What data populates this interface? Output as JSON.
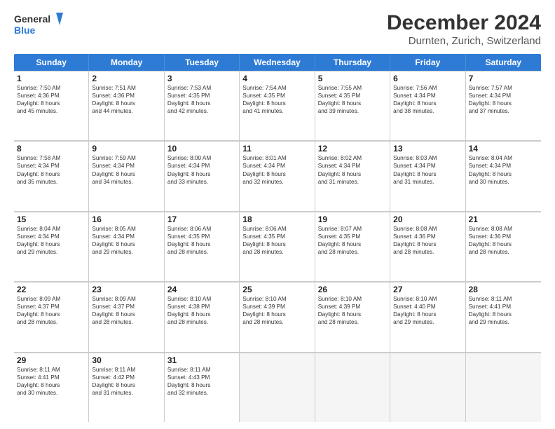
{
  "header": {
    "logo_general": "General",
    "logo_blue": "Blue",
    "month": "December 2024",
    "location": "Durnten, Zurich, Switzerland"
  },
  "weekdays": [
    "Sunday",
    "Monday",
    "Tuesday",
    "Wednesday",
    "Thursday",
    "Friday",
    "Saturday"
  ],
  "rows": [
    [
      {
        "day": "1",
        "lines": [
          "Sunrise: 7:50 AM",
          "Sunset: 4:36 PM",
          "Daylight: 8 hours",
          "and 45 minutes."
        ]
      },
      {
        "day": "2",
        "lines": [
          "Sunrise: 7:51 AM",
          "Sunset: 4:36 PM",
          "Daylight: 8 hours",
          "and 44 minutes."
        ]
      },
      {
        "day": "3",
        "lines": [
          "Sunrise: 7:53 AM",
          "Sunset: 4:35 PM",
          "Daylight: 8 hours",
          "and 42 minutes."
        ]
      },
      {
        "day": "4",
        "lines": [
          "Sunrise: 7:54 AM",
          "Sunset: 4:35 PM",
          "Daylight: 8 hours",
          "and 41 minutes."
        ]
      },
      {
        "day": "5",
        "lines": [
          "Sunrise: 7:55 AM",
          "Sunset: 4:35 PM",
          "Daylight: 8 hours",
          "and 39 minutes."
        ]
      },
      {
        "day": "6",
        "lines": [
          "Sunrise: 7:56 AM",
          "Sunset: 4:34 PM",
          "Daylight: 8 hours",
          "and 38 minutes."
        ]
      },
      {
        "day": "7",
        "lines": [
          "Sunrise: 7:57 AM",
          "Sunset: 4:34 PM",
          "Daylight: 8 hours",
          "and 37 minutes."
        ]
      }
    ],
    [
      {
        "day": "8",
        "lines": [
          "Sunrise: 7:58 AM",
          "Sunset: 4:34 PM",
          "Daylight: 8 hours",
          "and 35 minutes."
        ]
      },
      {
        "day": "9",
        "lines": [
          "Sunrise: 7:59 AM",
          "Sunset: 4:34 PM",
          "Daylight: 8 hours",
          "and 34 minutes."
        ]
      },
      {
        "day": "10",
        "lines": [
          "Sunrise: 8:00 AM",
          "Sunset: 4:34 PM",
          "Daylight: 8 hours",
          "and 33 minutes."
        ]
      },
      {
        "day": "11",
        "lines": [
          "Sunrise: 8:01 AM",
          "Sunset: 4:34 PM",
          "Daylight: 8 hours",
          "and 32 minutes."
        ]
      },
      {
        "day": "12",
        "lines": [
          "Sunrise: 8:02 AM",
          "Sunset: 4:34 PM",
          "Daylight: 8 hours",
          "and 31 minutes."
        ]
      },
      {
        "day": "13",
        "lines": [
          "Sunrise: 8:03 AM",
          "Sunset: 4:34 PM",
          "Daylight: 8 hours",
          "and 31 minutes."
        ]
      },
      {
        "day": "14",
        "lines": [
          "Sunrise: 8:04 AM",
          "Sunset: 4:34 PM",
          "Daylight: 8 hours",
          "and 30 minutes."
        ]
      }
    ],
    [
      {
        "day": "15",
        "lines": [
          "Sunrise: 8:04 AM",
          "Sunset: 4:34 PM",
          "Daylight: 8 hours",
          "and 29 minutes."
        ]
      },
      {
        "day": "16",
        "lines": [
          "Sunrise: 8:05 AM",
          "Sunset: 4:34 PM",
          "Daylight: 8 hours",
          "and 29 minutes."
        ]
      },
      {
        "day": "17",
        "lines": [
          "Sunrise: 8:06 AM",
          "Sunset: 4:35 PM",
          "Daylight: 8 hours",
          "and 28 minutes."
        ]
      },
      {
        "day": "18",
        "lines": [
          "Sunrise: 8:06 AM",
          "Sunset: 4:35 PM",
          "Daylight: 8 hours",
          "and 28 minutes."
        ]
      },
      {
        "day": "19",
        "lines": [
          "Sunrise: 8:07 AM",
          "Sunset: 4:35 PM",
          "Daylight: 8 hours",
          "and 28 minutes."
        ]
      },
      {
        "day": "20",
        "lines": [
          "Sunrise: 8:08 AM",
          "Sunset: 4:36 PM",
          "Daylight: 8 hours",
          "and 28 minutes."
        ]
      },
      {
        "day": "21",
        "lines": [
          "Sunrise: 8:08 AM",
          "Sunset: 4:36 PM",
          "Daylight: 8 hours",
          "and 28 minutes."
        ]
      }
    ],
    [
      {
        "day": "22",
        "lines": [
          "Sunrise: 8:09 AM",
          "Sunset: 4:37 PM",
          "Daylight: 8 hours",
          "and 28 minutes."
        ]
      },
      {
        "day": "23",
        "lines": [
          "Sunrise: 8:09 AM",
          "Sunset: 4:37 PM",
          "Daylight: 8 hours",
          "and 28 minutes."
        ]
      },
      {
        "day": "24",
        "lines": [
          "Sunrise: 8:10 AM",
          "Sunset: 4:38 PM",
          "Daylight: 8 hours",
          "and 28 minutes."
        ]
      },
      {
        "day": "25",
        "lines": [
          "Sunrise: 8:10 AM",
          "Sunset: 4:39 PM",
          "Daylight: 8 hours",
          "and 28 minutes."
        ]
      },
      {
        "day": "26",
        "lines": [
          "Sunrise: 8:10 AM",
          "Sunset: 4:39 PM",
          "Daylight: 8 hours",
          "and 28 minutes."
        ]
      },
      {
        "day": "27",
        "lines": [
          "Sunrise: 8:10 AM",
          "Sunset: 4:40 PM",
          "Daylight: 8 hours",
          "and 29 minutes."
        ]
      },
      {
        "day": "28",
        "lines": [
          "Sunrise: 8:11 AM",
          "Sunset: 4:41 PM",
          "Daylight: 8 hours",
          "and 29 minutes."
        ]
      }
    ],
    [
      {
        "day": "29",
        "lines": [
          "Sunrise: 8:11 AM",
          "Sunset: 4:41 PM",
          "Daylight: 8 hours",
          "and 30 minutes."
        ]
      },
      {
        "day": "30",
        "lines": [
          "Sunrise: 8:11 AM",
          "Sunset: 4:42 PM",
          "Daylight: 8 hours",
          "and 31 minutes."
        ]
      },
      {
        "day": "31",
        "lines": [
          "Sunrise: 8:11 AM",
          "Sunset: 4:43 PM",
          "Daylight: 8 hours",
          "and 32 minutes."
        ]
      },
      {
        "day": "",
        "lines": []
      },
      {
        "day": "",
        "lines": []
      },
      {
        "day": "",
        "lines": []
      },
      {
        "day": "",
        "lines": []
      }
    ]
  ]
}
